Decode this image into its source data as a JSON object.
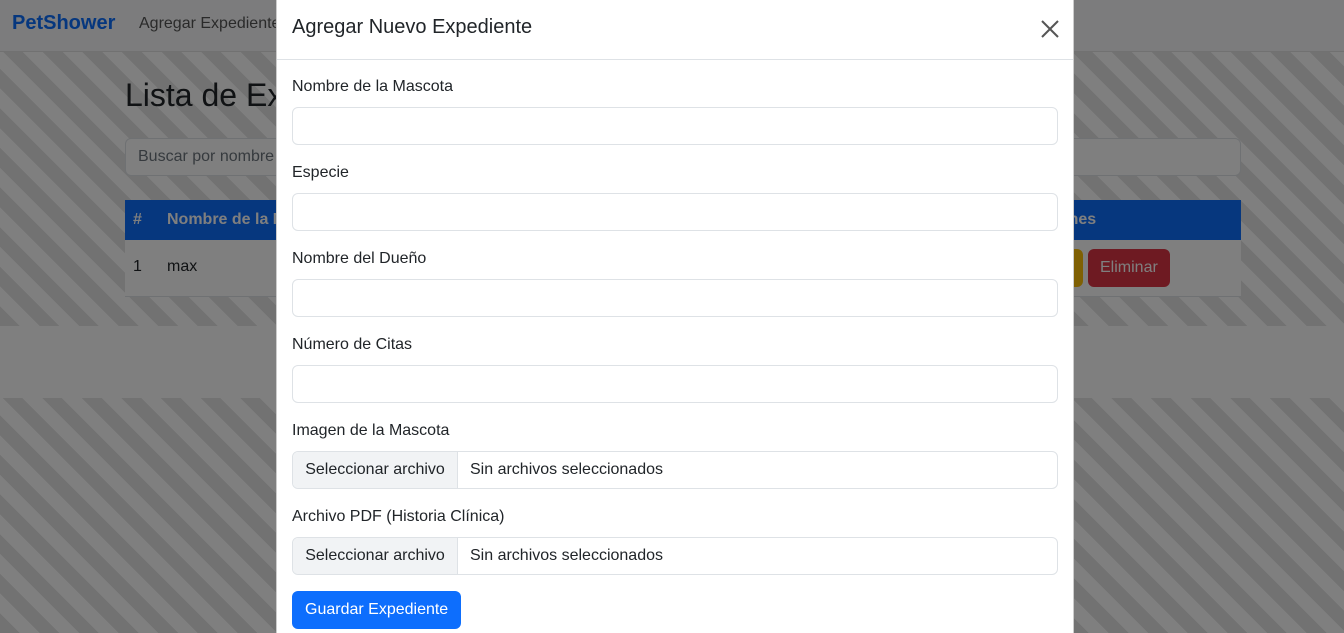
{
  "navbar": {
    "brand": "PetShower",
    "link": "Agregar Expediente"
  },
  "page": {
    "title": "Lista de Expedientes",
    "search_placeholder": "Buscar por nombre",
    "table": {
      "headers": [
        "#",
        "Nombre de la Mascota",
        "Acciones"
      ],
      "rows": [
        {
          "num": "1",
          "name": "max",
          "delete_label": "Eliminar"
        }
      ]
    }
  },
  "modal": {
    "title": "Agregar Nuevo Expediente",
    "fields": {
      "pet_name_label": "Nombre de la Mascota",
      "species_label": "Especie",
      "owner_label": "Nombre del Dueño",
      "appointments_label": "Número de Citas",
      "image_label": "Imagen de la Mascota",
      "pdf_label": "Archivo PDF (Historia Clínica)"
    },
    "file_button": "Seleccionar archivo",
    "no_file": "Sin archivos seleccionados",
    "submit": "Guardar Expediente"
  },
  "colors": {
    "primary": "#0d6efd",
    "danger": "#dc3545",
    "warning": "#ffc107"
  }
}
